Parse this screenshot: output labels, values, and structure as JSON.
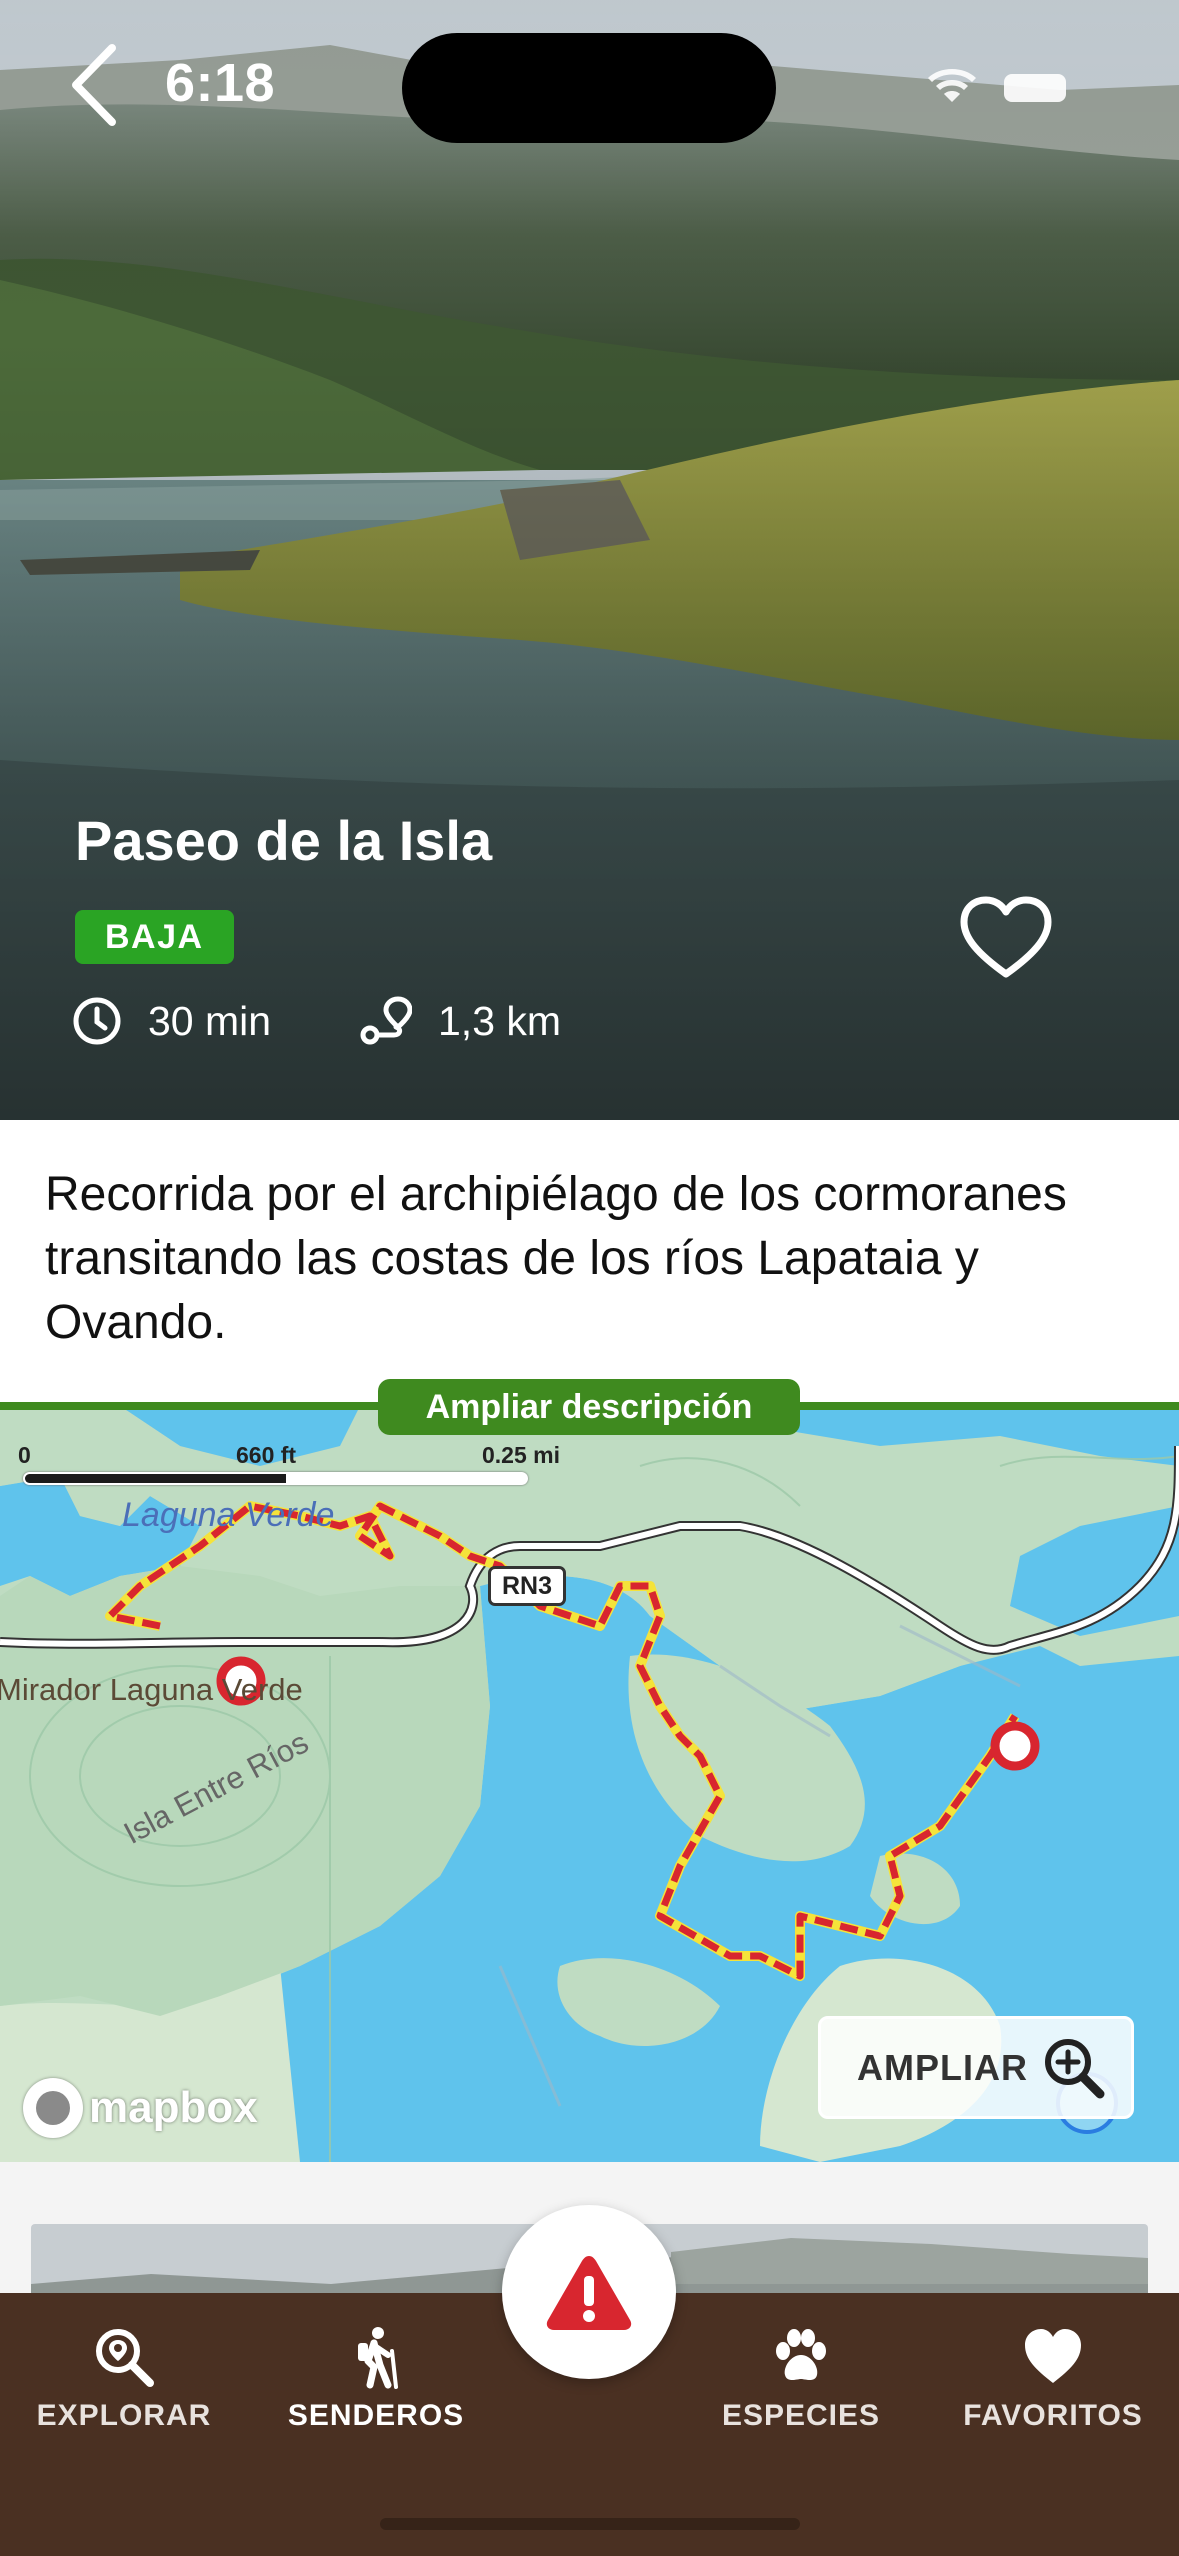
{
  "status": {
    "time": "6:18"
  },
  "trail": {
    "title": "Paseo de la Isla",
    "difficulty": "BAJA",
    "duration": "30 min",
    "distance": "1,3 km",
    "description": "Recorrida por el archipiélago de los cormoranes transitando las costas de los ríos Lapataia y Ovando.",
    "expand_label": "Ampliar descripción"
  },
  "map": {
    "scale": {
      "zero": "0",
      "feet": "660 ft",
      "miles": "0.25 mi"
    },
    "labels": {
      "laguna": "Laguna Verde",
      "mirador": "Mirador Laguna Verde",
      "isla": "Isla Entre Ríos",
      "road": "RN3"
    },
    "attribution": "mapbox",
    "zoom_label": "AMPLIAR"
  },
  "tabs": [
    {
      "label": "EXPLORAR",
      "icon": "search-location-icon"
    },
    {
      "label": "SENDEROS",
      "icon": "hiker-icon",
      "active": true
    },
    {
      "label": "ESPECIES",
      "icon": "paw-icon"
    },
    {
      "label": "FAVORITOS",
      "icon": "heart-icon"
    }
  ],
  "colors": {
    "badge": "#2aa424",
    "accent_green": "#3f8a1f",
    "tabbar": "#4a3022",
    "route_red": "#d8262f",
    "alert_red": "#d8262f"
  }
}
